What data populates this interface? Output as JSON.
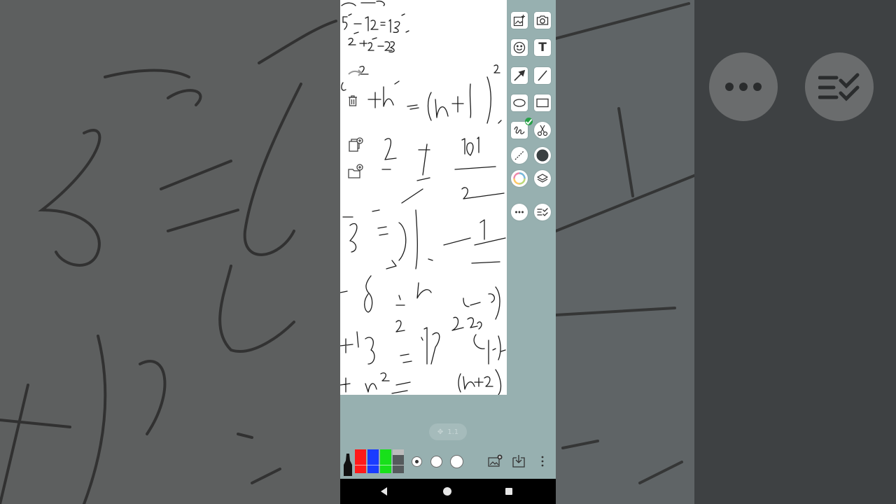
{
  "app": {
    "zoom_level": "1.1"
  },
  "toolbar": {
    "tools": [
      {
        "name": "insert-image",
        "icon": "image-add-icon"
      },
      {
        "name": "camera",
        "icon": "camera-icon"
      },
      {
        "name": "sticker",
        "icon": "smiley-icon"
      },
      {
        "name": "text",
        "icon": "text-icon",
        "glyph": "T"
      },
      {
        "name": "arrow",
        "icon": "arrow-icon"
      },
      {
        "name": "line",
        "icon": "line-icon"
      },
      {
        "name": "ellipse",
        "icon": "ellipse-icon"
      },
      {
        "name": "rectangle",
        "icon": "rectangle-icon"
      },
      {
        "name": "pen",
        "icon": "freehand-icon",
        "selected": true
      },
      {
        "name": "cut",
        "icon": "scissors-icon"
      },
      {
        "name": "eraser",
        "icon": "eraser-icon"
      },
      {
        "name": "color",
        "icon": "color-dot-icon",
        "value": "#3a4042"
      },
      {
        "name": "palette",
        "icon": "palette-icon"
      },
      {
        "name": "layers",
        "icon": "layers-icon"
      },
      {
        "name": "more",
        "icon": "more-icon"
      },
      {
        "name": "checklist",
        "icon": "checklist-icon"
      }
    ]
  },
  "canvas_side_tools": [
    {
      "name": "delete",
      "icon": "trash-icon"
    },
    {
      "name": "add-page",
      "icon": "page-add-icon"
    },
    {
      "name": "add-folder",
      "icon": "folder-add-icon"
    }
  ],
  "bottombar": {
    "pens": [
      {
        "name": "black-marker",
        "color": "#111111"
      },
      {
        "name": "red-marker",
        "color": "#ff1a1a"
      },
      {
        "name": "blue-marker",
        "color": "#1a3cff"
      },
      {
        "name": "green-marker",
        "color": "#18e01a"
      },
      {
        "name": "gray-marker",
        "color": "#555a5c"
      }
    ],
    "sizes": [
      "small",
      "medium",
      "large"
    ],
    "actions": [
      "insert-image",
      "save-download",
      "overflow-menu"
    ]
  },
  "nav": [
    "back",
    "home",
    "recents"
  ],
  "colors": {
    "accent_check": "#26a047",
    "panel_bg": "#97b0b0"
  }
}
